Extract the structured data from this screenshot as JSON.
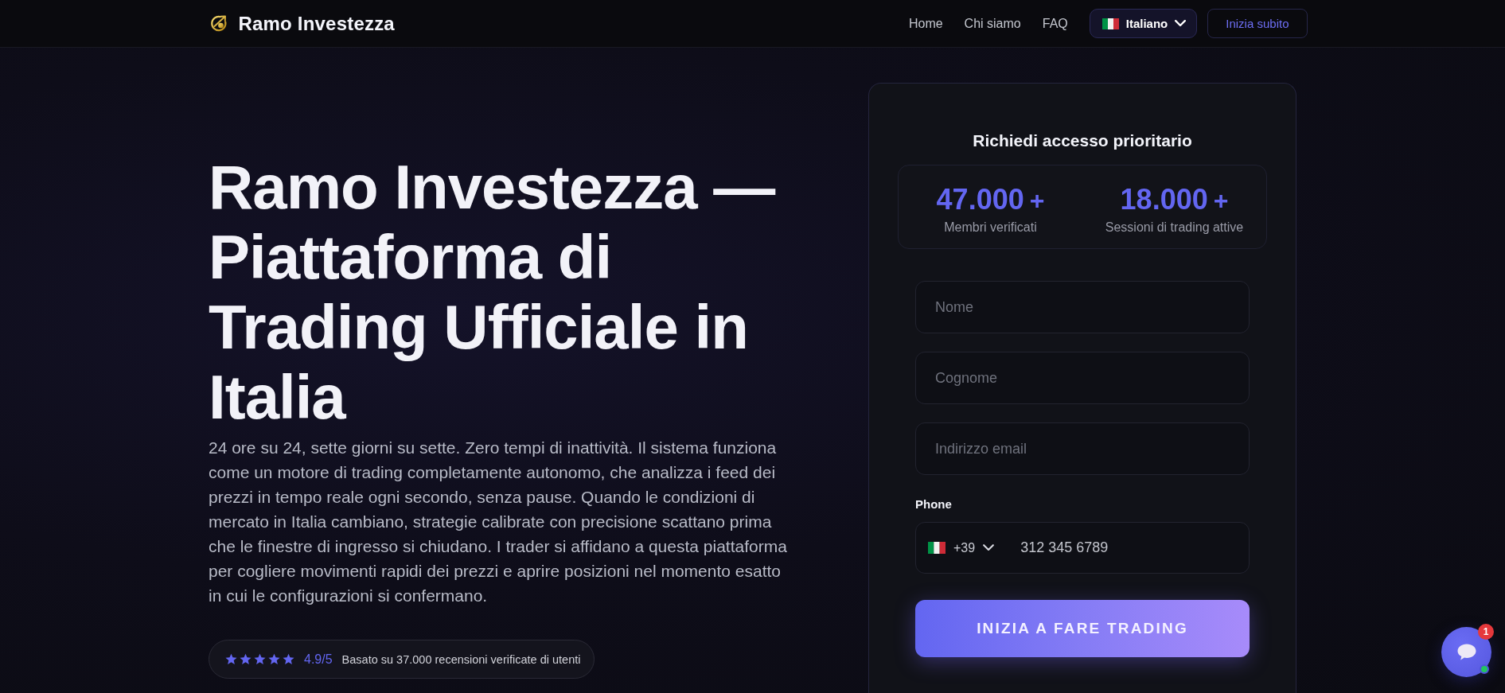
{
  "header": {
    "brand": "Ramo Investezza",
    "nav": [
      {
        "label": "Home"
      },
      {
        "label": "Chi siamo"
      },
      {
        "label": "FAQ"
      }
    ],
    "language": {
      "label": "Italiano"
    },
    "cta": "Inizia subito"
  },
  "hero": {
    "title": "Ramo Investezza — Piattaforma di Trading Ufficiale in Italia",
    "description": "24 ore su 24, sette giorni su sette. Zero tempi di inattività. Il sistema funziona come un motore di trading completamente autonomo, che analizza i feed dei prezzi in tempo reale ogni secondo, senza pause. Quando le condizioni di mercato in Italia cambiano, strategie calibrate con precisione scattano prima che le finestre di ingresso si chiudano. I trader si affidano a questa piattaforma per cogliere movimenti rapidi dei prezzi e aprire posizioni nel momento esatto in cui le configurazioni si confermano.",
    "rating": {
      "stars": 5,
      "score": "4.9/5",
      "text": "Basato su 37.000 recensioni verificate di utenti"
    }
  },
  "form": {
    "title": "Richiedi accesso prioritario",
    "stats": [
      {
        "value": "47.000",
        "suffix": "+",
        "label": "Membri verificati"
      },
      {
        "value": "18.000",
        "suffix": "+",
        "label": "Sessioni di trading attive"
      }
    ],
    "fields": [
      {
        "placeholder": "Nome"
      },
      {
        "placeholder": "Cognome"
      },
      {
        "placeholder": "Indirizzo email"
      }
    ],
    "phone": {
      "label": "Phone",
      "dial_code": "+39",
      "placeholder": "312 345 6789"
    },
    "submit": "INIZIA A FARE TRADING"
  },
  "chat": {
    "badge": "1",
    "online": true
  }
}
